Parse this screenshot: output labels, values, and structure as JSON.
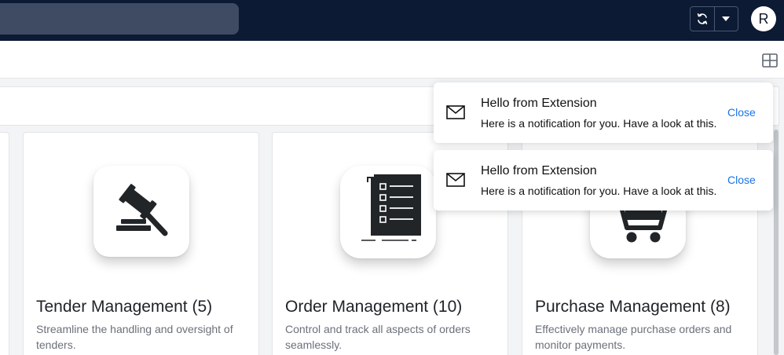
{
  "header": {
    "avatar_initial": "R",
    "icons": {
      "sync": "sync-icon",
      "caret": "caret-down-icon",
      "layout": "grid-layout-icon"
    }
  },
  "cards": [
    {
      "title": "Tender Management (5)",
      "description": "Streamline the handling and oversight of tenders.",
      "icon": "gavel-icon"
    },
    {
      "title": "Order Management (10)",
      "description": "Control and track all aspects of orders seamlessly.",
      "icon": "checklist-document-icon"
    },
    {
      "title": "Purchase Management (8)",
      "description": "Effectively manage purchase orders and monitor payments.",
      "icon": "shopping-cart-icon"
    }
  ],
  "notifications": [
    {
      "title": "Hello from Extension",
      "body": "Here is a notification for you. Have a look at this.",
      "close_label": "Close",
      "icon": "mail-icon"
    },
    {
      "title": "Hello from Extension",
      "body": "Here is a notification for you. Have a look at this.",
      "close_label": "Close",
      "icon": "mail-icon"
    }
  ],
  "colors": {
    "topbar": "#0c1a33",
    "link": "#1a73e8",
    "background": "#f3f4f6"
  }
}
